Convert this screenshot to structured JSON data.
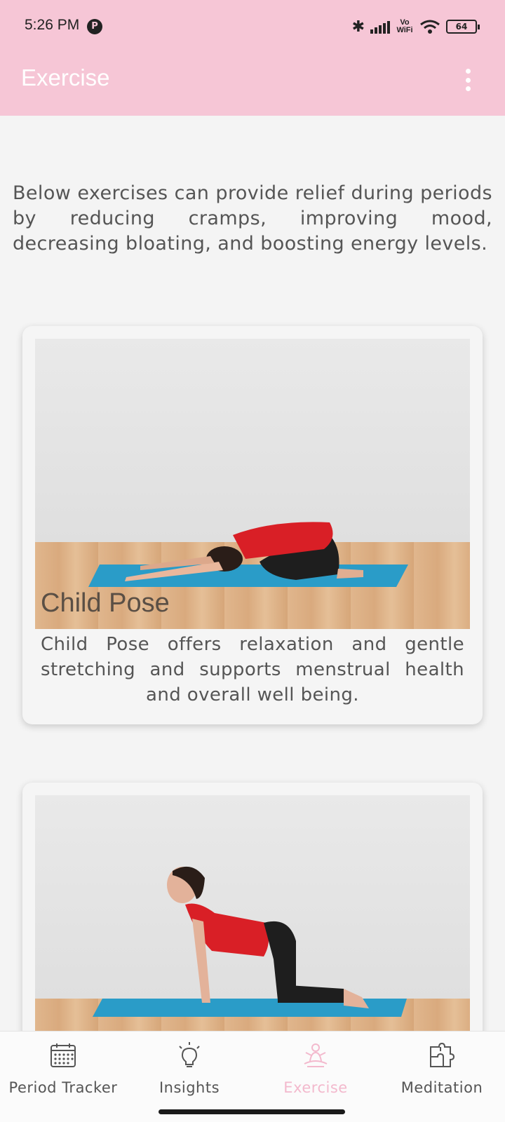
{
  "status_bar": {
    "time": "5:26 PM",
    "network": "Vo WiFi",
    "battery": "64"
  },
  "app_bar": {
    "title": "Exercise"
  },
  "intro": "Below exercises can provide relief during periods by reducing cramps, improving mood, decreasing bloating, and boosting energy levels.",
  "cards": [
    {
      "title": "Child Pose",
      "description": "Child Pose offers relaxation and gentle stretching and supports menstrual health and overall well being."
    },
    {
      "title": "",
      "description": ""
    }
  ],
  "bottom_nav": [
    {
      "label": "Period Tracker",
      "icon": "calendar-icon",
      "active": false
    },
    {
      "label": "Insights",
      "icon": "lightbulb-icon",
      "active": false
    },
    {
      "label": "Exercise",
      "icon": "yoga-icon",
      "active": true
    },
    {
      "label": "Meditation",
      "icon": "puzzle-icon",
      "active": false
    }
  ],
  "colors": {
    "app_bar": "#f6c6d6",
    "active_tab": "#f3b9cd",
    "mat": "#2a9cc8",
    "top": "#e02a2a"
  }
}
